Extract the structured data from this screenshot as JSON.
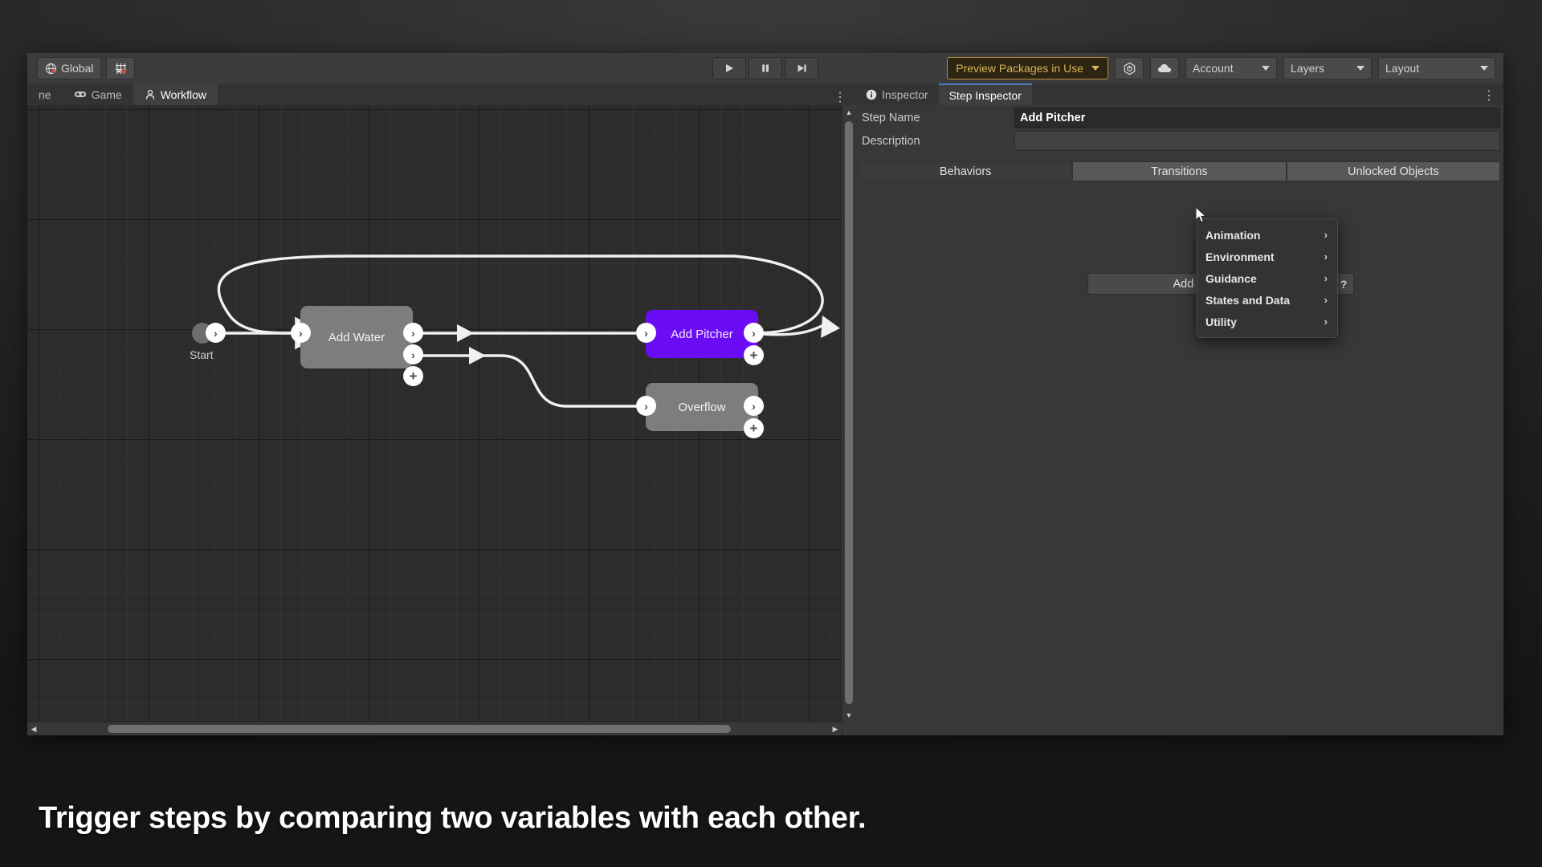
{
  "toolbar": {
    "global_label": "Global",
    "global_icon": "globe-icon",
    "grid_icon": "grid-snap-icon",
    "play_icon": "play-icon",
    "pause_icon": "pause-icon",
    "step_icon": "step-forward-icon",
    "preview_packages_label": "Preview Packages in Use",
    "collab_icon": "unity-package-icon",
    "cloud_icon": "cloud-icon",
    "account_label": "Account",
    "layers_label": "Layers",
    "layout_label": "Layout"
  },
  "tabs": {
    "kebab": "⋮",
    "items": [
      {
        "label": "ne",
        "icon": "scene-icon",
        "active": false
      },
      {
        "label": "Game",
        "icon": "gamepad-icon",
        "active": false
      },
      {
        "label": "Workflow",
        "icon": "workflow-icon",
        "active": true
      }
    ]
  },
  "inspector": {
    "kebab": "⋮",
    "tabs": [
      {
        "label": "Inspector",
        "icon": "info-icon",
        "active": false
      },
      {
        "label": "Step Inspector",
        "icon": "",
        "active": true
      }
    ],
    "fields": [
      {
        "label": "Step Name",
        "value": "Add Pitcher",
        "empty": false
      },
      {
        "label": "Description",
        "value": "",
        "empty": true
      }
    ],
    "segments": [
      {
        "label": "Behaviors",
        "active": true
      },
      {
        "label": "Transitions",
        "active": false
      },
      {
        "label": "Unlocked Objects",
        "active": false
      }
    ],
    "add_behavior_label": "Add Behavior",
    "help_label": "?"
  },
  "context_menu": {
    "items": [
      {
        "label": "Animation",
        "arrow": "›"
      },
      {
        "label": "Environment",
        "arrow": "›"
      },
      {
        "label": "Guidance",
        "arrow": "›"
      },
      {
        "label": "States and Data",
        "arrow": "›"
      },
      {
        "label": "Utility",
        "arrow": "›"
      }
    ]
  },
  "graph": {
    "start_label": "Start",
    "nodes": [
      {
        "id": "add-water",
        "label": "Add Water",
        "selected": false
      },
      {
        "id": "add-pitcher",
        "label": "Add Pitcher",
        "selected": true
      },
      {
        "id": "overflow",
        "label": "Overflow",
        "selected": false
      }
    ],
    "port_glyph": "›",
    "plus_glyph": "+"
  },
  "caption": {
    "text": "Trigger steps by comparing two variables with each other."
  },
  "colors": {
    "selected_node": "#6a0df5",
    "node": "#7d7d7d",
    "preview_pill_text": "#d8b357",
    "preview_pill_border": "#b8903a",
    "active_tab_accent": "#4b7fc4",
    "panel_bg": "#383838",
    "graph_bg": "#2c2c2c"
  }
}
